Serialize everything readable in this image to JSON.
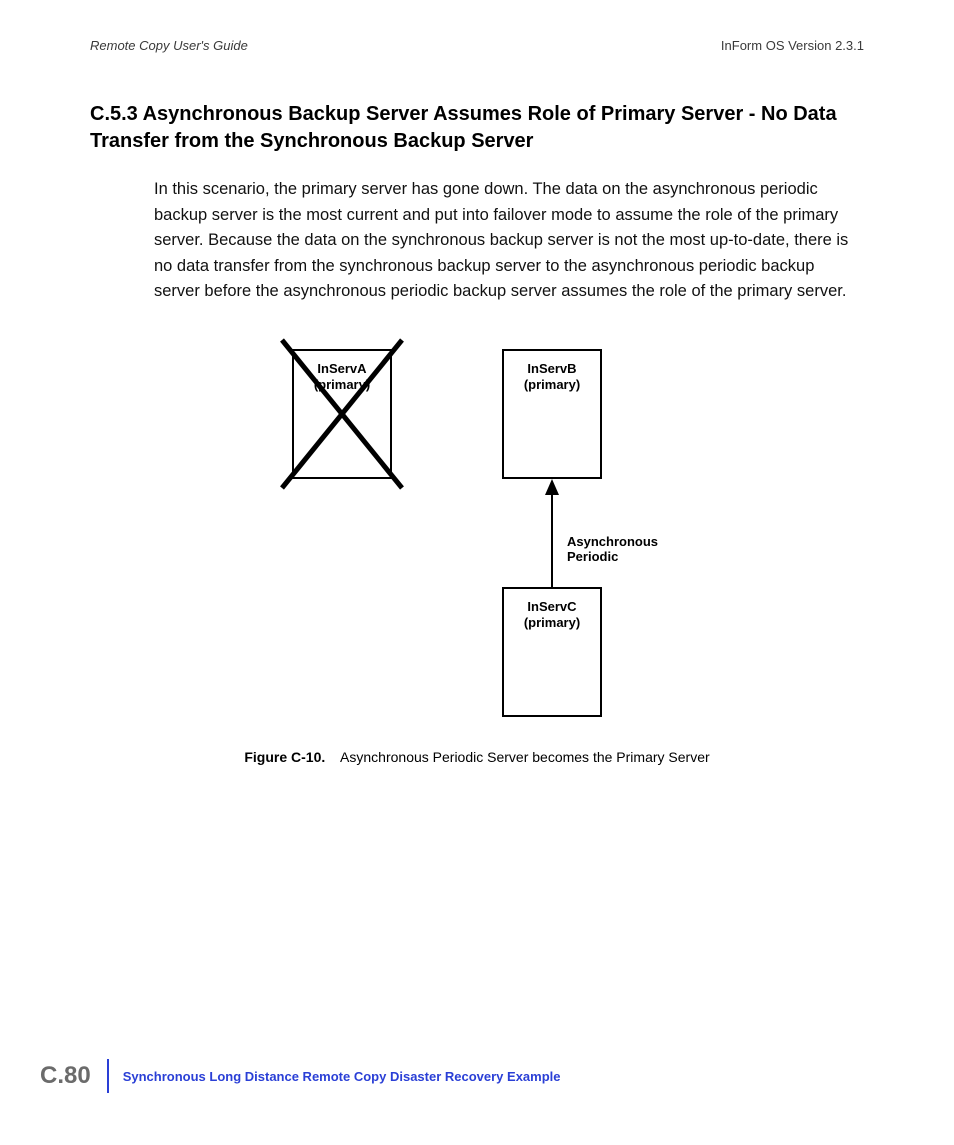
{
  "header": {
    "left": "Remote Copy User's Guide",
    "right": "InForm OS Version 2.3.1"
  },
  "section": {
    "number": "C.5.3",
    "title_full": "C.5.3 Asynchronous Backup Server Assumes Role of Primary Server - No Data Transfer from the Synchronous Backup Server"
  },
  "body": "In this scenario, the primary server has gone down. The data on the asynchronous periodic backup server is the most current and put into failover mode to assume the role of the primary server. Because the data on the synchronous backup server is not the most up-to-date, there is no data transfer from the synchronous backup server to the asynchronous periodic backup server before the asynchronous periodic backup server assumes the role of the primary server.",
  "diagram": {
    "serverA": {
      "name": "InServA",
      "role": "(primary)"
    },
    "serverB": {
      "name": "InServB",
      "role": "(primary)"
    },
    "serverC": {
      "name": "InServC",
      "role": "(primary)"
    },
    "arrow_label_line1": "Asynchronous",
    "arrow_label_line2": "Periodic"
  },
  "figure": {
    "number": "Figure C-10.",
    "caption": "Asynchronous Periodic Server becomes the Primary Server"
  },
  "footer": {
    "page": "C.80",
    "section_ref": "Synchronous Long Distance Remote Copy Disaster Recovery Example"
  }
}
